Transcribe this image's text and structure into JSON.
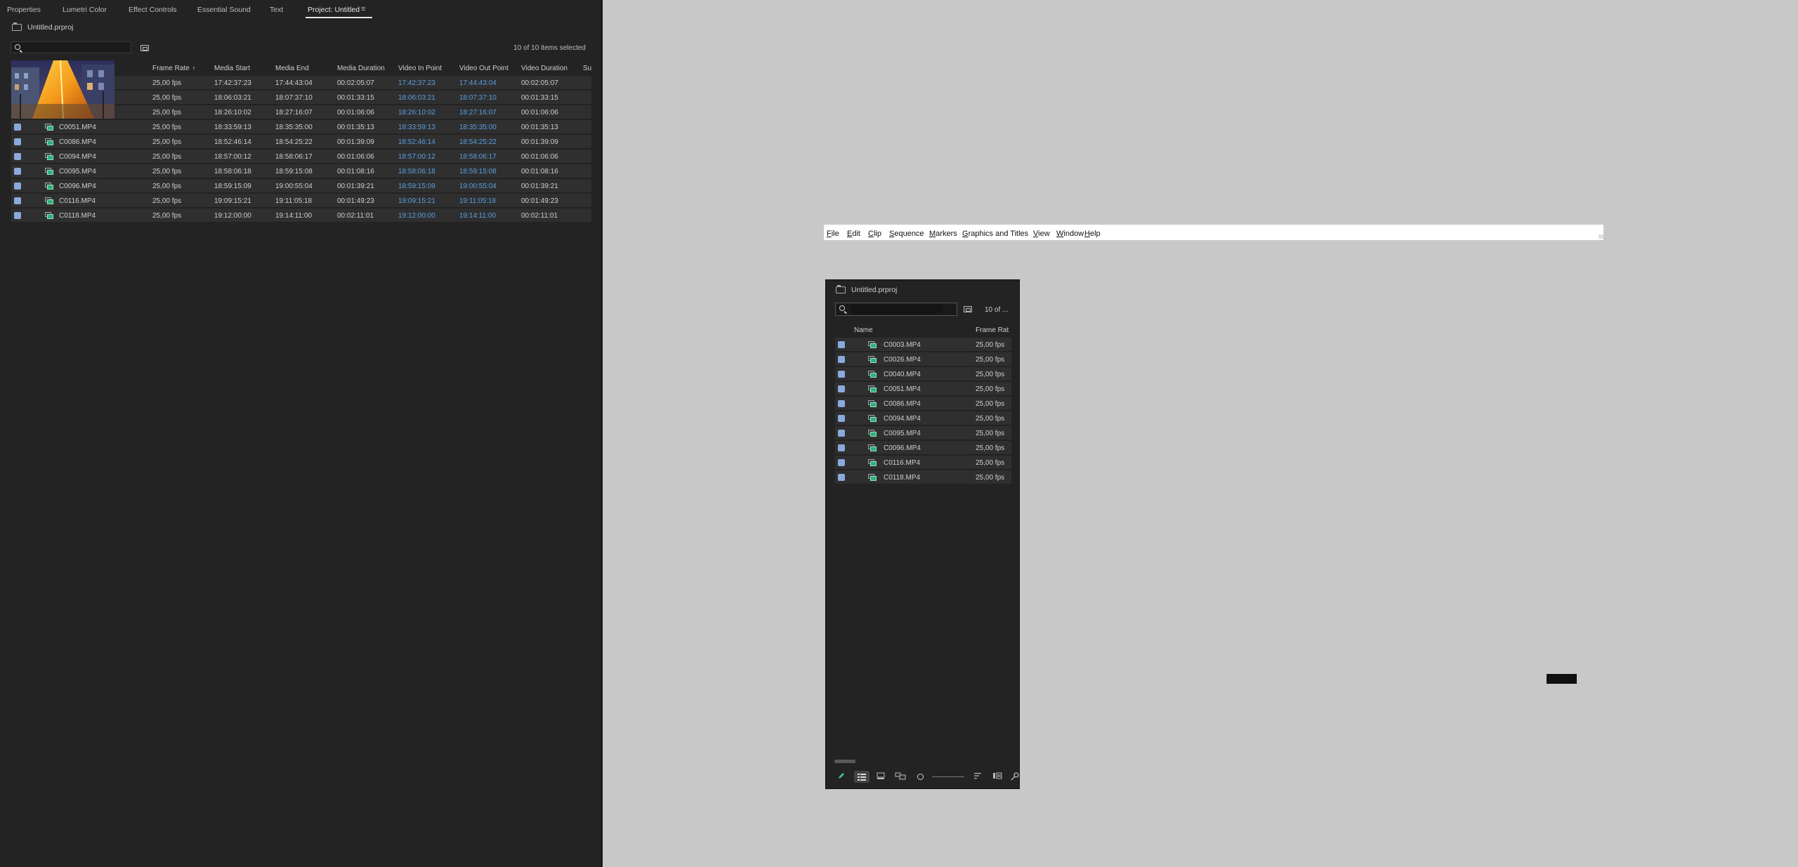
{
  "main_panel": {
    "tabs": [
      "Properties",
      "Lumetri Color",
      "Effect Controls",
      "Essential Sound",
      "Text",
      "Project: Untitled"
    ],
    "tab_menu_glyph": "≡",
    "project_file": "Untitled.prproj",
    "search": {
      "value": "",
      "placeholder": ""
    },
    "selection_count": "10 of 10 items selected",
    "columns": [
      "Frame Rate",
      "Media Start",
      "Media End",
      "Media Duration",
      "Video In Point",
      "Video Out Point",
      "Video Duration",
      "Su"
    ],
    "sorted_column": "Frame Rate",
    "sort_direction_glyph": "↑",
    "rows": [
      {
        "name": "",
        "frame_rate": "25,00 fps",
        "media_start": "17:42:37:23",
        "media_end": "17:44:43:04",
        "media_duration": "00:02:05:07",
        "video_in": "17:42:37:23",
        "video_out": "17:44:43:04",
        "video_duration": "00:02:05:07"
      },
      {
        "name": "",
        "frame_rate": "25,00 fps",
        "media_start": "18:06:03:21",
        "media_end": "18:07:37:10",
        "media_duration": "00:01:33:15",
        "video_in": "18:06:03:21",
        "video_out": "18:07:37:10",
        "video_duration": "00:01:33:15"
      },
      {
        "name": "",
        "frame_rate": "25,00 fps",
        "media_start": "18:26:10:02",
        "media_end": "18:27:16:07",
        "media_duration": "00:01:06:06",
        "video_in": "18:26:10:02",
        "video_out": "18:27:16:07",
        "video_duration": "00:01:06:06"
      },
      {
        "name": "C0051.MP4",
        "frame_rate": "25,00 fps",
        "media_start": "18:33:59:13",
        "media_end": "18:35:35:00",
        "media_duration": "00:01:35:13",
        "video_in": "18:33:59:13",
        "video_out": "18:35:35:00",
        "video_duration": "00:01:35:13"
      },
      {
        "name": "C0086.MP4",
        "frame_rate": "25,00 fps",
        "media_start": "18:52:46:14",
        "media_end": "18:54:25:22",
        "media_duration": "00:01:39:09",
        "video_in": "18:52:46:14",
        "video_out": "18:54:25:22",
        "video_duration": "00:01:39:09"
      },
      {
        "name": "C0094.MP4",
        "frame_rate": "25,00 fps",
        "media_start": "18:57:00:12",
        "media_end": "18:58:06:17",
        "media_duration": "00:01:06:06",
        "video_in": "18:57:00:12",
        "video_out": "18:58:06:17",
        "video_duration": "00:01:06:06"
      },
      {
        "name": "C0095.MP4",
        "frame_rate": "25,00 fps",
        "media_start": "18:58:06:18",
        "media_end": "18:59:15:08",
        "media_duration": "00:01:08:16",
        "video_in": "18:58:06:18",
        "video_out": "18:59:15:08",
        "video_duration": "00:01:08:16"
      },
      {
        "name": "C0096.MP4",
        "frame_rate": "25,00 fps",
        "media_start": "18:59:15:09",
        "media_end": "19:00:55:04",
        "media_duration": "00:01:39:21",
        "video_in": "18:59:15:09",
        "video_out": "19:00:55:04",
        "video_duration": "00:01:39:21"
      },
      {
        "name": "C0116.MP4",
        "frame_rate": "25,00 fps",
        "media_start": "19:09:15:21",
        "media_end": "19:11:05:18",
        "media_duration": "00:01:49:23",
        "video_in": "19:09:15:21",
        "video_out": "19:11:05:18",
        "video_duration": "00:01:49:23"
      },
      {
        "name": "C0118.MP4",
        "frame_rate": "25,00 fps",
        "media_start": "19:12:00:00",
        "media_end": "19:14:11:00",
        "media_duration": "00:02:11:01",
        "video_in": "19:12:00:00",
        "video_out": "19:14:11:00",
        "video_duration": "00:02:11:01"
      }
    ]
  },
  "menubar": {
    "items": [
      {
        "label": "File",
        "mnemonic": "F"
      },
      {
        "label": "Edit",
        "mnemonic": "E"
      },
      {
        "label": "Clip",
        "mnemonic": "C"
      },
      {
        "label": "Sequence",
        "mnemonic": "S"
      },
      {
        "label": "Markers",
        "mnemonic": "M"
      },
      {
        "label": "Graphics and Titles",
        "mnemonic": "G"
      },
      {
        "label": "View",
        "mnemonic": "V"
      },
      {
        "label": "Window",
        "mnemonic": "W"
      },
      {
        "label": "Help",
        "mnemonic": "H"
      }
    ]
  },
  "float_panel": {
    "project_file": "Untitled.prproj",
    "search": {
      "value": "",
      "placeholder": ""
    },
    "selection_count": "10 of ...",
    "columns": [
      "Name",
      "Frame Rat"
    ],
    "rows": [
      {
        "name": "C0003.MP4",
        "frame_rate": "25,00 fps"
      },
      {
        "name": "C0026.MP4",
        "frame_rate": "25,00 fps"
      },
      {
        "name": "C0040.MP4",
        "frame_rate": "25,00 fps"
      },
      {
        "name": "C0051.MP4",
        "frame_rate": "25,00 fps"
      },
      {
        "name": "C0086.MP4",
        "frame_rate": "25,00 fps"
      },
      {
        "name": "C0094.MP4",
        "frame_rate": "25,00 fps"
      },
      {
        "name": "C0095.MP4",
        "frame_rate": "25,00 fps"
      },
      {
        "name": "C0096.MP4",
        "frame_rate": "25,00 fps"
      },
      {
        "name": "C0116.MP4",
        "frame_rate": "25,00 fps"
      },
      {
        "name": "C0118.MP4",
        "frame_rate": "25,00 fps"
      }
    ],
    "toolbar_icons": [
      "pencil-icon",
      "list-view-icon",
      "icon-view-icon",
      "freeform-view-icon",
      "zoom-slider",
      "sort-icon",
      "automate-icon",
      "find-icon"
    ]
  },
  "colors": {
    "in_out_point": "#5b9fe0",
    "checkbox": "#8aa9dc",
    "panel_bg": "#232323",
    "row_bg": "#2f2f2f",
    "desktop_bg": "#c8c8c8"
  }
}
